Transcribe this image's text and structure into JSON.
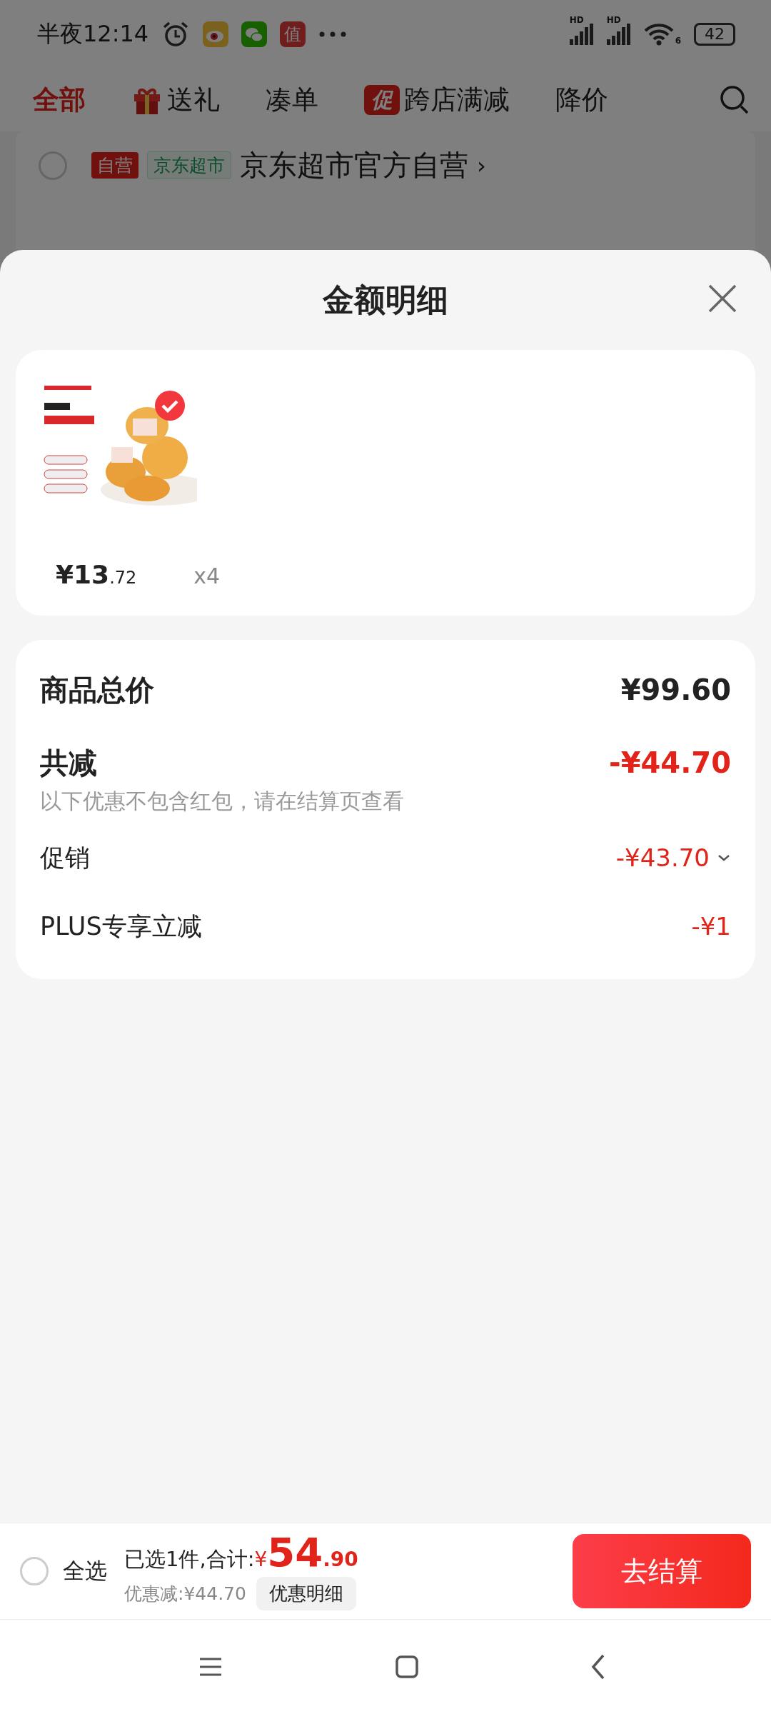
{
  "status_bar": {
    "time": "半夜12:14",
    "app_badge": "值",
    "network_labels": [
      "HD",
      "HD"
    ],
    "wifi_label": "6",
    "battery": "42"
  },
  "tabs": [
    {
      "label": "全部",
      "selected": true,
      "kind": "plain"
    },
    {
      "label": "送礼",
      "selected": false,
      "kind": "gift"
    },
    {
      "label": "凑单",
      "selected": false,
      "kind": "plain"
    },
    {
      "label": "跨店满减",
      "selected": false,
      "kind": "badge",
      "badge": "促"
    },
    {
      "label": "降价",
      "selected": false,
      "kind": "plain"
    }
  ],
  "store": {
    "checked": false,
    "tags": [
      {
        "label": "自营",
        "kind": "solid"
      },
      {
        "label": "京东超市",
        "kind": "outline"
      }
    ],
    "name": "京东超市官方自营",
    "chevron": "›"
  },
  "sheet": {
    "title": "金额明细",
    "products": [
      {
        "kind": "picture",
        "selected": true,
        "price_main": "¥13",
        "price_decimal": ".72",
        "quantity": "x4"
      }
    ],
    "summary": [
      {
        "kind": "total",
        "label": "商品总价",
        "amount": "¥99.60"
      },
      {
        "kind": "discount_total",
        "label": "共减",
        "amount": "-¥44.70",
        "note": "以下优惠不包含红包，请在结算页查看"
      },
      {
        "kind": "item",
        "label": "促销",
        "amount": "-¥43.70",
        "expandable": true
      },
      {
        "kind": "item",
        "label": "PLUS专享立减",
        "amount": "-¥1",
        "expandable": false
      }
    ]
  },
  "bottom_bar": {
    "select_all": {
      "label": "全选",
      "checked": false
    },
    "selected_text": "已选1件,合计:",
    "currency": "¥",
    "total_main": "54",
    "total_decimal": ".90",
    "discount_text": "优惠减:¥44.70",
    "details_button": "优惠明细",
    "checkout_button": "去结算"
  }
}
